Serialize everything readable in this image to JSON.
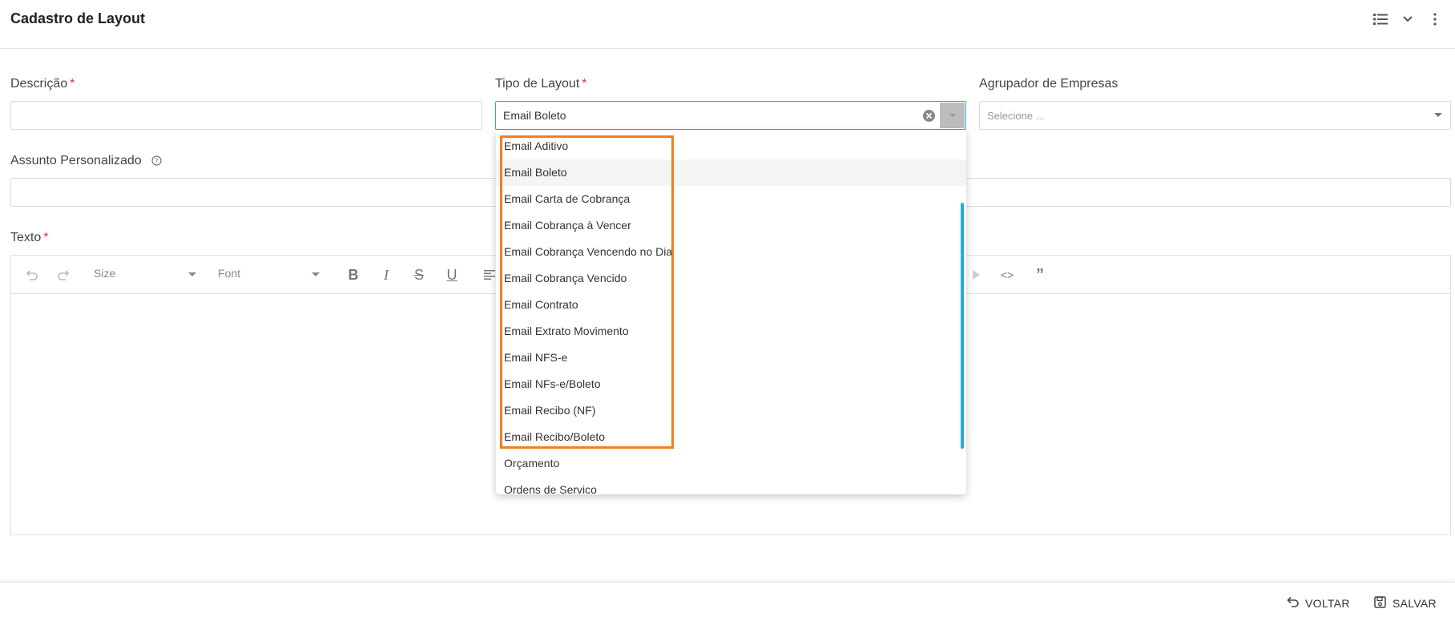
{
  "header": {
    "title": "Cadastro de Layout",
    "icons": [
      "list-view-icon",
      "chevron-down-icon",
      "more-vertical-icon"
    ]
  },
  "form": {
    "descricao": {
      "label": "Descrição",
      "required_mark": "*",
      "value": ""
    },
    "tipo_layout": {
      "label": "Tipo de Layout",
      "required_mark": "*",
      "value": "Email Boleto"
    },
    "agrupador": {
      "label": "Agrupador de Empresas",
      "placeholder": "Selecione ..."
    },
    "assunto": {
      "label": "Assunto Personalizado",
      "value": ""
    },
    "texto": {
      "label": "Texto",
      "required_mark": "*"
    }
  },
  "editor": {
    "size_label": "Size",
    "font_label": "Font",
    "tools": [
      "undo-icon",
      "redo-icon",
      "bold-icon",
      "italic-icon",
      "strike-icon",
      "underline-icon",
      "align-icon",
      "code-icon",
      "quote-icon"
    ]
  },
  "dropdown": {
    "selected": "Email Boleto",
    "options": [
      "Email Aditivo",
      "Email Boleto",
      "Email Carta de Cobrança",
      "Email Cobrança à Vencer",
      "Email Cobrança Vencendo no Dia",
      "Email Cobrança Vencido",
      "Email Contrato",
      "Email Extrato Movimento",
      "Email NFS-e",
      "Email NFs-e/Boleto",
      "Email Recibo (NF)",
      "Email Recibo/Boleto",
      "Orçamento",
      "Ordens de Servico"
    ]
  },
  "footer": {
    "back_label": "VOLTAR",
    "save_label": "SALVAR"
  },
  "colors": {
    "accent": "#29a9e0",
    "required": "#e53935",
    "highlight": "#f07f1e"
  }
}
